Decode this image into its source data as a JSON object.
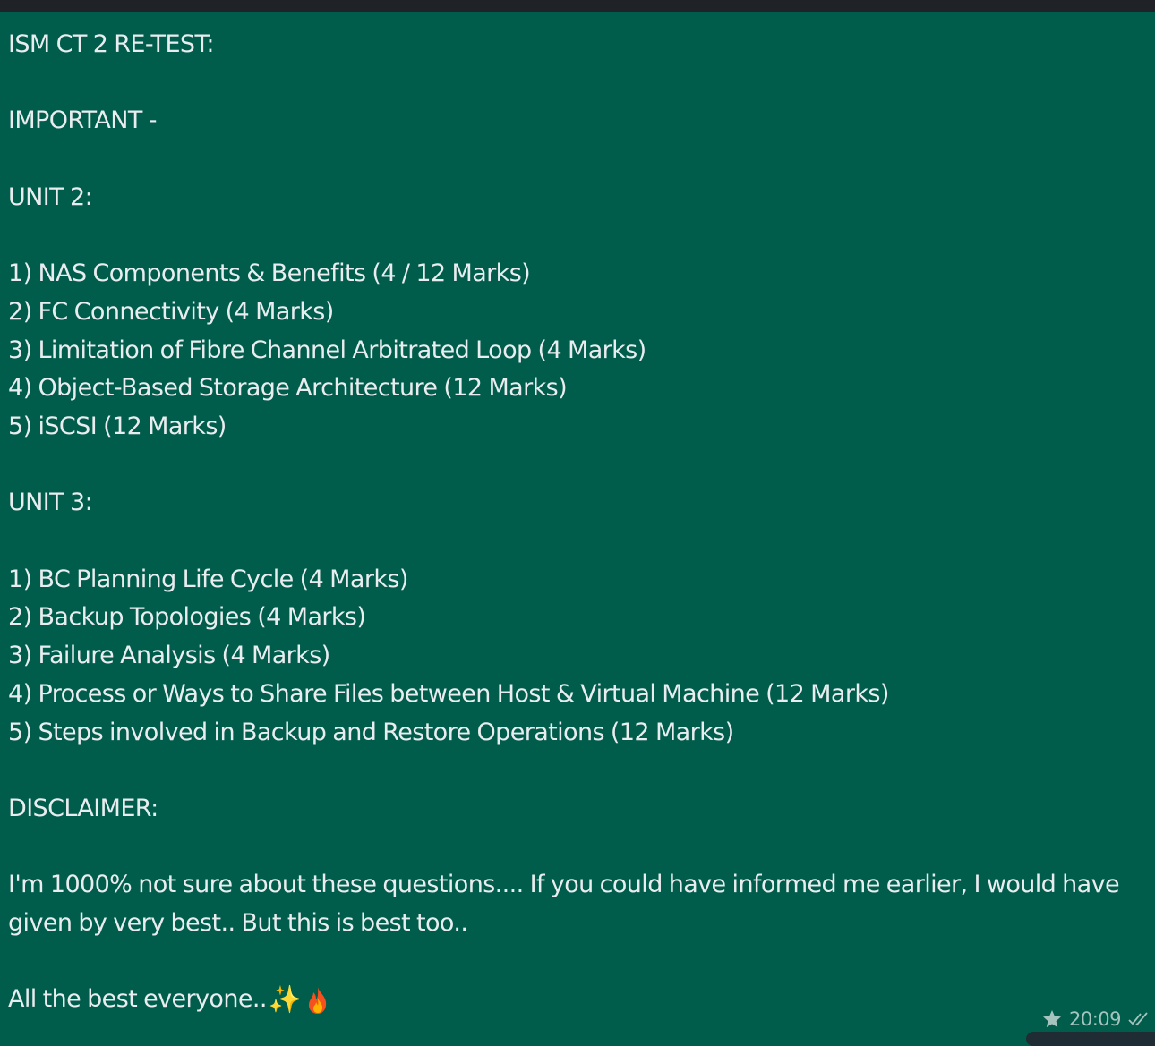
{
  "message": {
    "title": "ISM CT 2 RE-TEST:",
    "important": "IMPORTANT -",
    "unit2": {
      "heading": "UNIT 2:",
      "items": [
        "1) NAS Components & Benefits (4 / 12 Marks)",
        "2) FC Connectivity (4 Marks)",
        "3) Limitation of Fibre Channel Arbitrated Loop (4 Marks)",
        "4) Object-Based Storage Architecture (12 Marks)",
        "5) iSCSI (12 Marks)"
      ]
    },
    "unit3": {
      "heading": "UNIT 3:",
      "items": [
        "1) BC Planning Life Cycle (4 Marks)",
        "2) Backup Topologies (4 Marks)",
        "3) Failure Analysis (4 Marks)",
        "4) Process or Ways to Share Files between Host & Virtual Machine (12 Marks)",
        "5) Steps involved in Backup and Restore Operations (12 Marks)"
      ]
    },
    "disclaimer_heading": "DISCLAIMER:",
    "disclaimer_text": "I'm 1000% not sure about these questions.... If you could have informed me earlier, I would have given by very best.. But this is best too..",
    "closing": "All the best everyone.."
  },
  "meta": {
    "time": "20:09",
    "starred_icon": "star-icon",
    "status_icon": "double-check-icon"
  },
  "colors": {
    "bubble": "#005c4b",
    "text": "#e9edef",
    "meta_text": "#a5c4bd"
  }
}
